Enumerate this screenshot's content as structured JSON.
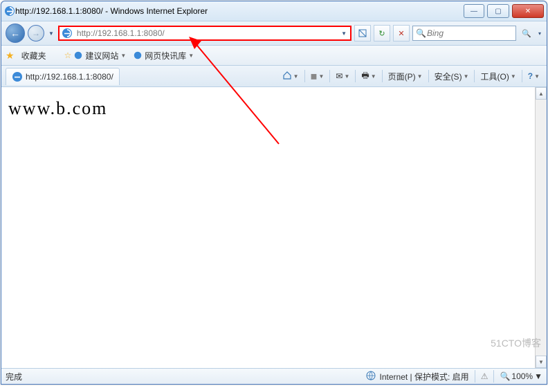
{
  "titlebar": {
    "title": "http://192.168.1.1:8080/ - Windows Internet Explorer"
  },
  "nav": {
    "url": "http://192.168.1.1:8080/"
  },
  "search": {
    "placeholder": "Bing"
  },
  "favbar": {
    "label": "收藏夹",
    "link1": "建议网站",
    "link2": "网页快讯库"
  },
  "tab": {
    "title": "http://192.168.1.1:8080/"
  },
  "toolbar": {
    "page": "页面(P)",
    "safety": "安全(S)",
    "tools": "工具(O)"
  },
  "page": {
    "body_text": "www.b.com"
  },
  "status": {
    "left": "完成",
    "zone": "Internet | 保护模式: 启用",
    "zoom": "100%"
  },
  "watermark": "51CTO博客"
}
